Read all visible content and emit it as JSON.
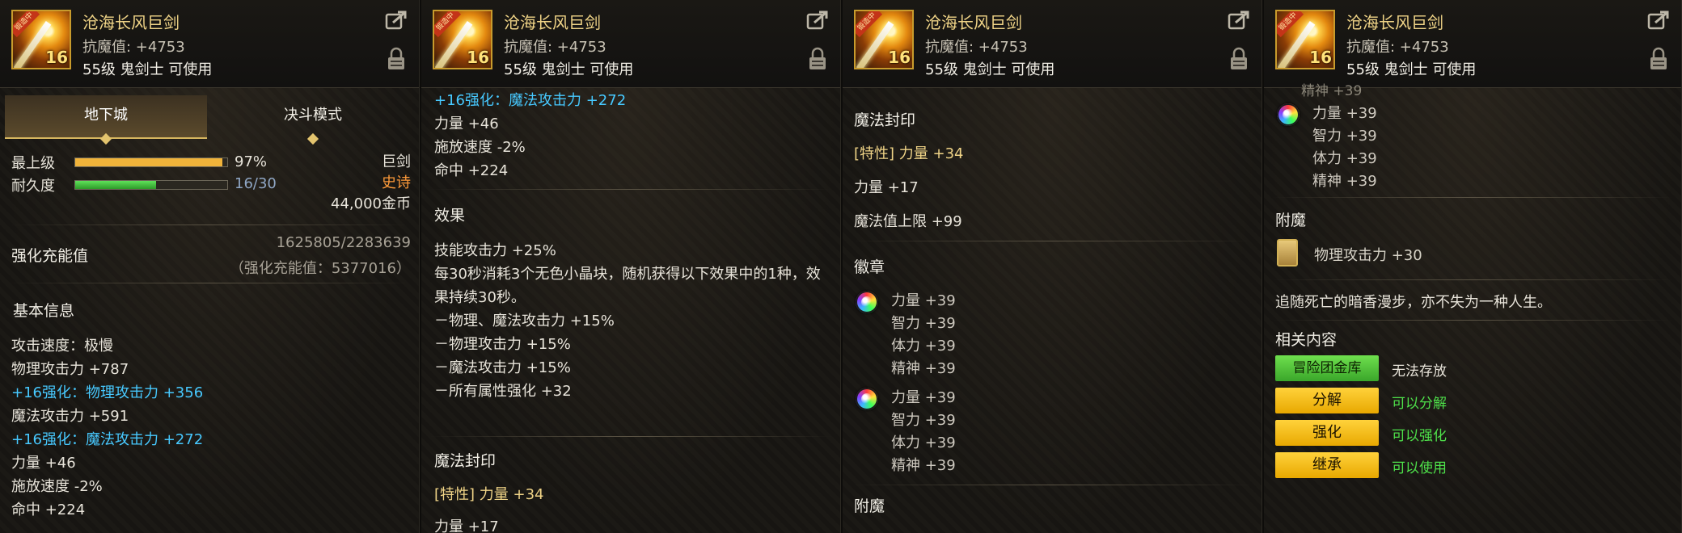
{
  "item": {
    "name": "沧海长风巨剑",
    "resist": "抗魔值: +4753",
    "requirement": "55级 鬼剑士 可使用",
    "icon_ribbon": "锻造中",
    "icon_level": "16"
  },
  "panel1": {
    "tabs": [
      "地下城",
      "决斗模式"
    ],
    "grade_label": "最上级",
    "grade_value": "97%",
    "grade_fraction": 0.97,
    "durability_label": "耐久度",
    "durability_value": "16/30",
    "durability_fraction": 0.533,
    "weapon_type": "巨剑",
    "rarity": "史诗",
    "price": "44,000金币",
    "charge_label": "强化充能值",
    "charge_value": "1625805/2283639",
    "charge_note": "（强化充能值：5377016）",
    "basic_info_title": "基本信息",
    "lines": [
      {
        "text": "攻击速度：极慢",
        "cls": ""
      },
      {
        "text": "物理攻击力 +787",
        "cls": ""
      },
      {
        "text": "+16强化：物理攻击力 +356",
        "cls": "cyan"
      },
      {
        "text": "魔法攻击力 +591",
        "cls": ""
      },
      {
        "text": "+16强化：魔法攻击力 +272",
        "cls": "cyan"
      },
      {
        "text": "力量 +46",
        "cls": ""
      },
      {
        "text": "施放速度 -2%",
        "cls": ""
      },
      {
        "text": "命中 +224",
        "cls": ""
      }
    ]
  },
  "panel2": {
    "top_lines": [
      {
        "text": "+16强化：魔法攻击力 +272",
        "cls": "cyan"
      },
      {
        "text": "力量 +46",
        "cls": ""
      },
      {
        "text": "施放速度 -2%",
        "cls": ""
      },
      {
        "text": "命中 +224",
        "cls": ""
      }
    ],
    "effect_title": "效果",
    "effect_lines": [
      "技能攻击力 +25%",
      "每30秒消耗3个无色小晶块，随机获得以下效果中的1种，效",
      "果持续30秒。",
      "－物理、魔法攻击力 +15%",
      "－物理攻击力 +15%",
      "－魔法攻击力 +15%",
      "－所有属性强化 +32"
    ],
    "seal_title": "魔法封印",
    "seal_trait": "[特性] 力量 +34",
    "seal_cut": "力量 +17"
  },
  "panel3": {
    "seal_title": "魔法封印",
    "seal_trait": "[特性] 力量 +34",
    "seal_lines": [
      "力量 +17",
      "魔法值上限 +99"
    ],
    "emblem_title": "徽章",
    "emblems": [
      [
        "力量 +39",
        "智力 +39",
        "体力 +39",
        "精神 +39"
      ],
      [
        "力量 +39",
        "智力 +39",
        "体力 +39",
        "精神 +39"
      ]
    ],
    "enchant_title": "附魔"
  },
  "panel4": {
    "cut_top": "精神 +39",
    "emblem": [
      "力量 +39",
      "智力 +39",
      "体力 +39",
      "精神 +39"
    ],
    "enchant_title": "附魔",
    "enchant_value": "物理攻击力 +30",
    "flavor": "追随死亡的暗香漫步，亦不失为一种人生。",
    "related_title": "相关内容",
    "related": [
      {
        "button": "冒险团金库",
        "status": "无法存放",
        "style": "green"
      },
      {
        "button": "分解",
        "status": "可以分解",
        "style": "yellow"
      },
      {
        "button": "强化",
        "status": "可以强化",
        "style": "yellow"
      },
      {
        "button": "继承",
        "status": "可以使用",
        "style": "yellow"
      }
    ]
  },
  "colors": {
    "name": "#f0d487",
    "enhance": "#47c9ff",
    "rarity": "#ff9b3a",
    "ok": "#4ee04a",
    "grade_bar": "#f0b33a",
    "durability_bar": "#3fbf3a"
  },
  "icons": [
    "share-icon",
    "lock-icon",
    "emblem-orb-icon",
    "enchant-card-icon"
  ]
}
